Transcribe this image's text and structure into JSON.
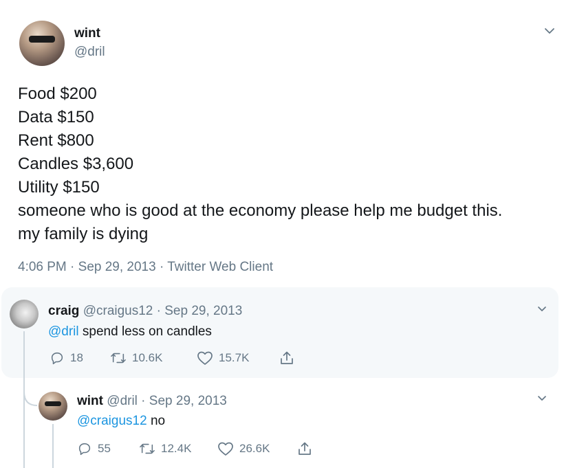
{
  "tweet": {
    "display_name": "wint",
    "handle": "@dril",
    "lines": [
      "Food $200",
      "Data $150",
      "Rent $800",
      "Candles $3,600",
      "Utility $150",
      "someone who is good at the economy please help me budget this.",
      "my family is dying"
    ],
    "meta": "4:06 PM · Sep 29, 2013 · Twitter Web Client"
  },
  "reply": {
    "display_name": "craig",
    "handle_date": "@craigus12 · Sep 29, 2013",
    "mention": "@dril",
    "text": " spend less on candles",
    "replies": "18",
    "retweets": "10.6K",
    "likes": "15.7K"
  },
  "reply2": {
    "display_name": "wint",
    "handle_date": "@dril · Sep 29, 2013",
    "mention": "@craigus12",
    "text": " no",
    "replies": "55",
    "retweets": "12.4K",
    "likes": "26.6K"
  },
  "colors": {
    "link": "#1b95e0",
    "muted": "#657786",
    "card_bg": "#f5f8fa"
  },
  "icons": [
    "chevron-down-icon",
    "reply-icon",
    "retweet-icon",
    "like-icon",
    "share-icon"
  ]
}
